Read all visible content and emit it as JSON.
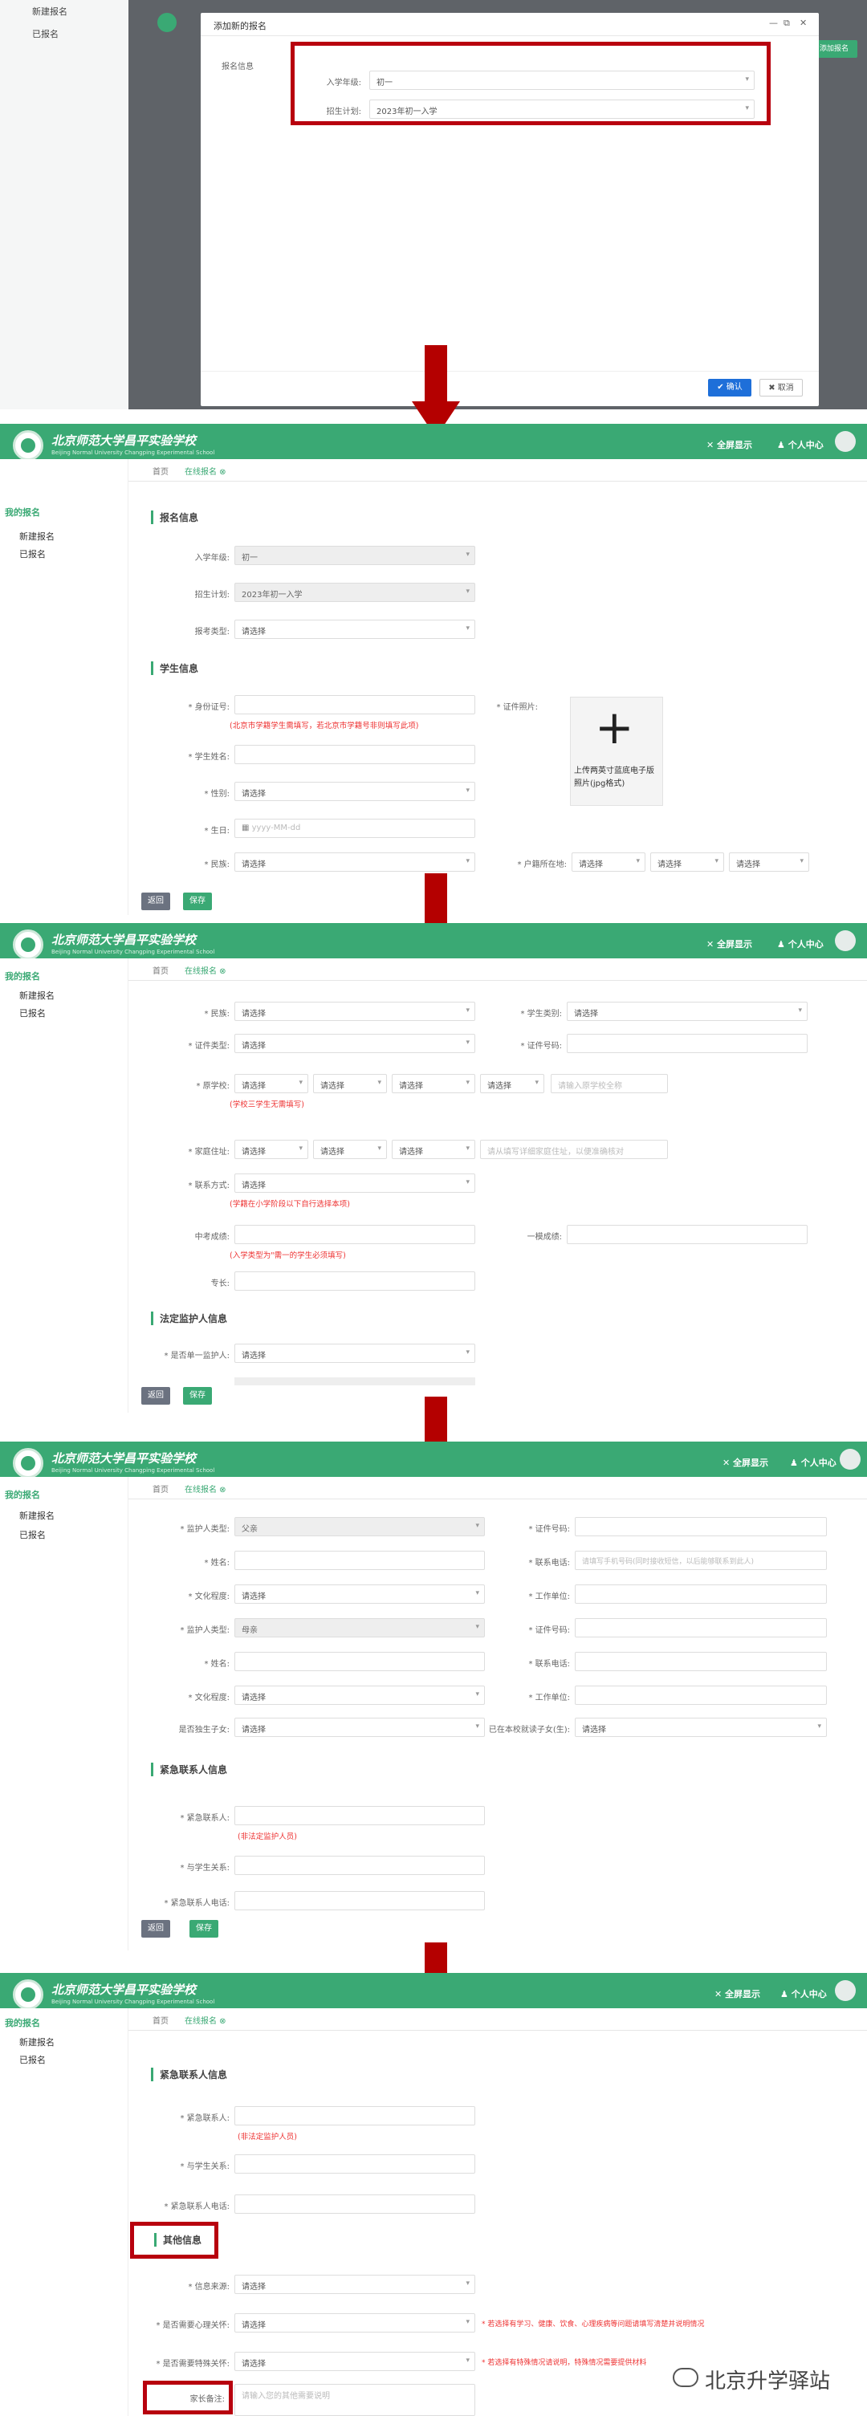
{
  "colors": {
    "brand_green": "#3aa974",
    "highlight_red": "#b8000e",
    "arrow_red": "#b40000",
    "error_text": "#e33333"
  },
  "header": {
    "school_name": "北京师范大学昌平实验学校",
    "school_sub": "Beijing Normal University Changping Experimental School",
    "msg_label": "✕ 全屏显示",
    "user_label": "♟ 个人中心"
  },
  "sidebar": {
    "title": "我的报名",
    "items": [
      "新建报名",
      "已报名"
    ]
  },
  "tabs": {
    "home": "首页",
    "current": "在线报名 ⊗"
  },
  "buttons": {
    "back": "返回",
    "save": "保存",
    "confirm": "✔ 确认",
    "cancel": "✖ 取消"
  },
  "panel1": {
    "dialog_title": "添加新的报名",
    "section": "报名信息",
    "entry_grade_label": "入学年级:",
    "entry_grade_value": "初一",
    "plan_label": "招生计划:",
    "plan_value": "2023年初一入学",
    "side_btn": "添加报名"
  },
  "panel2": {
    "section_signup": "报名信息",
    "fields": [
      {
        "label": "入学年级:",
        "value": "初一"
      },
      {
        "label": "招生计划:",
        "value": "2023年初一入学"
      },
      {
        "label": "报考类型:",
        "value": "请选择"
      }
    ],
    "section_student": "学生信息",
    "idcard_label": "* 身份证号:",
    "idcard_hint": "(北京市学籍学生需填写，若北京市学籍号非则填写此项)",
    "photo_label": "* 证件照片:",
    "photo_caption": "上传两英寸蓝底电子版照片(jpg格式)",
    "name_label": "* 学生姓名:",
    "gender_label": "* 性别:",
    "gender_value": "请选择",
    "birth_label": "* 生日:",
    "birth_placeholder": "yyyy-MM-dd",
    "nation_label": "* 民族:",
    "nation_value": "请选择",
    "hukou_label": "* 户籍所在地:",
    "hukou_values": [
      "请选择",
      "请选择",
      "请选择"
    ]
  },
  "panel3": {
    "rows": [
      {
        "label": "* 民族:",
        "value": "请选择",
        "label2": "* 学生类别:",
        "value2": "请选择"
      },
      {
        "label": "* 证件类型:",
        "value": "请选择",
        "label2": "* 证件号码:",
        "value2": ""
      }
    ],
    "school_label": "* 原学校:",
    "school_values": [
      "请选择",
      "请选择",
      "请选择",
      "请选择"
    ],
    "school_input": "请输入原学校全称",
    "school_hint": "(学校三学生无需填写)",
    "addr_label": "* 家庭住址:",
    "addr_values": [
      "请选择",
      "请选择",
      "请选择"
    ],
    "addr_input": "请从填写详细家庭住址，以便准确核对",
    "contact_label": "* 联系方式:",
    "contact_value": "请选择",
    "contact_hint": "(学籍在小学阶段以下自行选择本项)",
    "exam_label": "中考成绩:",
    "exam_hint": "(入学类型为\"需一的学生必须填写)",
    "rank_label": "一模成绩:",
    "grade_label": "专长:",
    "guardian_section": "法定监护人信息",
    "guardian_q": "* 是否单一监护人:",
    "guardian_value": "请选择"
  },
  "panel4": {
    "rows": [
      {
        "l1": "* 监护人类型:",
        "v1": "父亲",
        "l2": "* 证件号码:",
        "v2": ""
      },
      {
        "l1": "* 姓名:",
        "v1": "",
        "l2": "* 联系电话:",
        "v2": "请填写手机号码(同时接收短信，以后能够联系到此人)"
      },
      {
        "l1": "* 文化程度:",
        "v1": "请选择",
        "l2": "* 工作单位:",
        "v2": ""
      },
      {
        "l1": "* 监护人类型:",
        "v1": "母亲",
        "l2": "* 证件号码:",
        "v2": ""
      },
      {
        "l1": "* 姓名:",
        "v1": "",
        "l2": "* 联系电话:",
        "v2": ""
      },
      {
        "l1": "* 文化程度:",
        "v1": "请选择",
        "l2": "* 工作单位:",
        "v2": ""
      },
      {
        "l1": "是否独生子女:",
        "v1": "请选择",
        "l2": "已在本校就读子女(生):",
        "v2": "请选择"
      }
    ],
    "emergency_section": "紧急联系人信息",
    "em_name": "* 紧急联系人:",
    "em_hint": "(非法定监护人员)",
    "em_rel": "* 与学生关系:",
    "em_phone": "* 紧急联系人电话:"
  },
  "panel5": {
    "emergency_section": "紧急联系人信息",
    "em_name": "* 紧急联系人:",
    "em_hint": "(非法定监护人员)",
    "em_rel": "* 与学生关系:",
    "em_phone": "* 紧急联系人电话:",
    "other_section": "其他信息",
    "rows": [
      {
        "label": "* 信息来源:",
        "value": "请选择",
        "note": ""
      },
      {
        "label": "* 是否需要心理关怀:",
        "value": "请选择",
        "note": "* 若选择有学习、健康、饮食、心理疾病等问题请填写清楚并说明情况"
      },
      {
        "label": "* 是否需要特殊关怀:",
        "value": "请选择",
        "note": "* 若选择有特殊情况请说明，特殊情况需要提供材料"
      }
    ],
    "remark_label": "家长备注:",
    "remark_placeholder": "请输入您的其他需要说明"
  },
  "watermark": "北京升学驿站"
}
